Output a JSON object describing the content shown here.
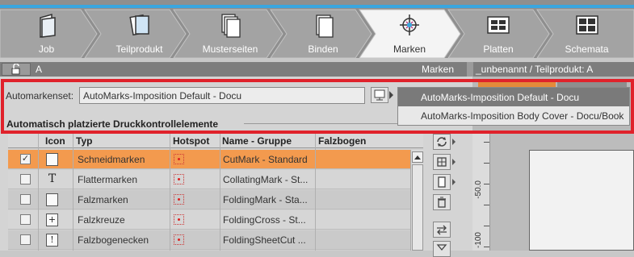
{
  "workflow": {
    "steps": [
      {
        "label": "Job",
        "icon": "folder-icon"
      },
      {
        "label": "Teilprodukt",
        "icon": "pages-icon"
      },
      {
        "label": "Musterseiten",
        "icon": "master-pages-icon"
      },
      {
        "label": "Binden",
        "icon": "binding-icon"
      },
      {
        "label": "Marken",
        "icon": "crop-mark-icon",
        "active": true
      },
      {
        "label": "Platten",
        "icon": "plates-icon"
      },
      {
        "label": "Schemata",
        "icon": "schema-icon"
      }
    ]
  },
  "title_strip": {
    "left_text": "A",
    "right_text": "Marken",
    "doc_text": "_unbenannt / Teilprodukt: A"
  },
  "automarks": {
    "label": "Automarkenset:",
    "value": "AutoMarks-Imposition Default - Docu",
    "options": [
      "AutoMarks-Imposition Default - Docu",
      "AutoMarks-Imposition Body Cover - Docu/Book"
    ]
  },
  "section_title": "Automatisch platzierte Druckkontrollelemente",
  "table": {
    "columns": [
      "Icon",
      "Typ",
      "Hotspot",
      "Name - Gruppe",
      "Falzbogen"
    ],
    "rows": [
      {
        "checked": "✓",
        "icon": "",
        "typ": "Schneidmarken",
        "name": "CutMark - Standard",
        "falzbogen": ""
      },
      {
        "checked": "",
        "icon": "T",
        "typ": "Flattermarken",
        "name": "CollatingMark - St...",
        "falzbogen": ""
      },
      {
        "checked": "",
        "icon": "",
        "typ": "Falzmarken",
        "name": "FoldingMark - Sta...",
        "falzbogen": ""
      },
      {
        "checked": "",
        "icon": "+",
        "typ": "Falzkreuze",
        "name": "FoldingCross - St...",
        "falzbogen": ""
      },
      {
        "checked": "",
        "icon": "!",
        "typ": "Falzbogenecken",
        "name": "FoldingSheetCut ...",
        "falzbogen": ""
      }
    ]
  },
  "ruler": {
    "labels": [
      "-50.0",
      "-100"
    ]
  },
  "colors": {
    "accent_blue": "#3aa6e0",
    "selection_orange": "#f39a4e",
    "highlight_red": "#e0222b"
  }
}
